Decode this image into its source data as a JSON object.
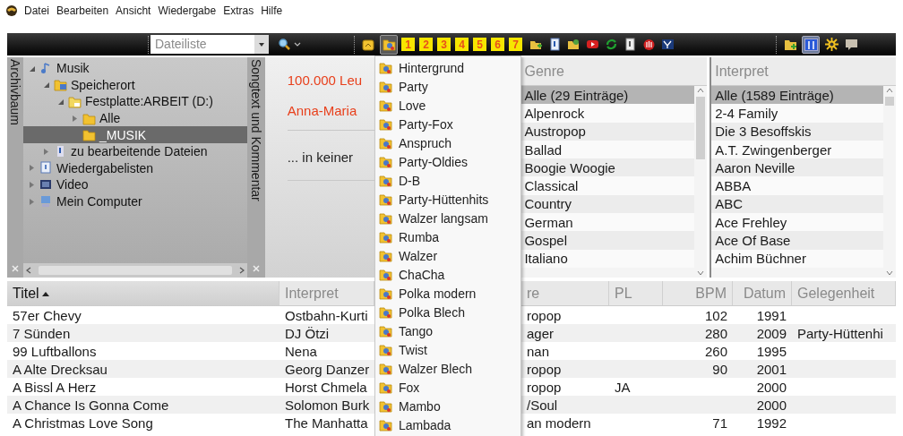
{
  "menu_bar": {
    "items": [
      "Datei",
      "Bearbeiten",
      "Ansicht",
      "Wiedergabe",
      "Extras",
      "Hilfe"
    ]
  },
  "toolbar": {
    "view_select": {
      "value": "Dateiliste"
    },
    "tag_button_pressed": true,
    "number_buttons": [
      "1",
      "2",
      "3",
      "4",
      "5",
      "6",
      "7"
    ],
    "columns_button_pressed": true
  },
  "archive_tab": {
    "label": "Archivbaum"
  },
  "archive_tree": {
    "items": [
      {
        "label": "Musik",
        "kind": "note",
        "expanded": true,
        "selected": false,
        "children": [
          {
            "label": "Speicherort",
            "kind": "storage",
            "expanded": true,
            "selected": false,
            "children": [
              {
                "label": "Festplatte:ARBEIT (D:)",
                "kind": "drive",
                "expanded": true,
                "selected": false,
                "children": [
                  {
                    "label": "Alle",
                    "kind": "folder",
                    "expanded": false,
                    "selected": false
                  },
                  {
                    "label": "_MUSIK",
                    "kind": "folder",
                    "selected": true
                  }
                ]
              }
            ]
          },
          {
            "label": "zu bearbeitende Dateien",
            "kind": "edit",
            "expanded": false,
            "selected": false
          }
        ]
      },
      {
        "label": "Wiedergabelisten",
        "kind": "playlist",
        "expanded": false,
        "selected": false
      },
      {
        "label": "Video",
        "kind": "video",
        "expanded": false,
        "selected": false
      },
      {
        "label": "Mein Computer",
        "kind": "computer",
        "expanded": false,
        "selected": false
      }
    ]
  },
  "songtext_tab": {
    "label": "Songtext und Kommentar"
  },
  "info_panel": {
    "lines": [
      {
        "kind": "title",
        "text": "100.000 Leu"
      },
      {
        "kind": "artist",
        "text": "Anna-Maria"
      },
      {
        "kind": "note",
        "text": "... in keiner"
      }
    ]
  },
  "filter_lists": [
    {
      "header": "Genre",
      "items": [
        {
          "label": "Alle (29 Einträge)",
          "selected": true
        },
        {
          "label": "Alpenrock",
          "selected": false
        },
        {
          "label": "Austropop",
          "selected": false
        },
        {
          "label": "Ballad",
          "selected": false
        },
        {
          "label": "Boogie Woogie",
          "selected": false
        },
        {
          "label": "Classical",
          "selected": false
        },
        {
          "label": "Country",
          "selected": false
        },
        {
          "label": "German",
          "selected": false
        },
        {
          "label": "Gospel",
          "selected": false
        },
        {
          "label": "Italiano",
          "selected": false
        }
      ]
    },
    {
      "header": "Interpret",
      "items": [
        {
          "label": "Alle (1589 Einträge)",
          "selected": true
        },
        {
          "label": "2-4 Family",
          "selected": false
        },
        {
          "label": "Die 3 Besoffskis",
          "selected": false
        },
        {
          "label": "A.T. Zwingenberger",
          "selected": false
        },
        {
          "label": "Aaron Neville",
          "selected": false
        },
        {
          "label": "ABBA",
          "selected": false
        },
        {
          "label": "ABC",
          "selected": false
        },
        {
          "label": "Ace Frehley",
          "selected": false
        },
        {
          "label": "Ace Of Base",
          "selected": false
        },
        {
          "label": "Achim Büchner",
          "selected": false
        }
      ]
    }
  ],
  "tag_menu": {
    "items": [
      "Hintergrund",
      "Party",
      "Love",
      "Party-Fox",
      "Anspruch",
      "Party-Oldies",
      "D-B",
      "Party-Hüttenhits",
      "Walzer langsam",
      "Rumba",
      "Walzer",
      "ChaCha",
      "Polka modern",
      "Polka Blech",
      "Tango",
      "Twist",
      "Walzer Blech",
      "Fox",
      "Mambo",
      "Lambada"
    ]
  },
  "table": {
    "columns": [
      {
        "label": "Titel",
        "sorted": true
      },
      {
        "label": "Interpret",
        "sorted": false
      },
      {
        "label": "re",
        "sorted": false
      },
      {
        "label": "PL",
        "sorted": false
      },
      {
        "label": "BPM",
        "sorted": false
      },
      {
        "label": "Datum",
        "sorted": false
      },
      {
        "label": "Gelegenheit",
        "sorted": false
      }
    ],
    "rows": [
      {
        "title": "57er Chevy",
        "artist": "Ostbahn-Kurti",
        "genre": "ropop",
        "bpm": "102",
        "date": "1991"
      },
      {
        "title": "7 Sünden",
        "artist": "DJ Ötzi",
        "genre": "ager",
        "bpm": "280",
        "date": "2009",
        "occasion": "Party-Hüttenhi"
      },
      {
        "title": "99 Luftballons",
        "artist": "Nena",
        "genre": "nan",
        "bpm": "260",
        "date": "1995"
      },
      {
        "title": "A Alte Drecksau",
        "artist": "Georg Danzer",
        "genre": "ropop",
        "bpm": "90",
        "date": "2001"
      },
      {
        "title": "A Bissl A Herz",
        "artist": "Horst Chmela",
        "genre": "ropop",
        "pl": "JA",
        "date": "2000"
      },
      {
        "title": "A Chance Is Gonna Come",
        "artist": "Solomon Burk",
        "genre": "/Soul",
        "date": "2000"
      },
      {
        "title": "A Christmas Love Song",
        "artist": "The Manhatta",
        "genre": "an modern",
        "bpm": "71",
        "date": "1992"
      }
    ]
  }
}
